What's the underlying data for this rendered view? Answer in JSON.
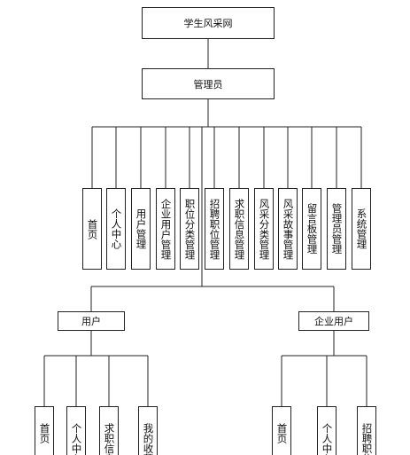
{
  "root": "学生风采网",
  "admin": {
    "title": "管理员",
    "modules": [
      "首页",
      "个人中心",
      "用户管理",
      "企业用户管理",
      "职位分类管理",
      "招聘职位管理",
      "求职信息管理",
      "风采分类管理",
      "风采故事管理",
      "留言板管理",
      "管理员管理",
      "系统管理"
    ]
  },
  "user": {
    "title": "用户",
    "modules": [
      "首页",
      "个人中心",
      "求职信息",
      "我的收藏"
    ]
  },
  "company": {
    "title": "企业用户",
    "modules": [
      "首页",
      "个人中心",
      "招聘职位"
    ]
  }
}
